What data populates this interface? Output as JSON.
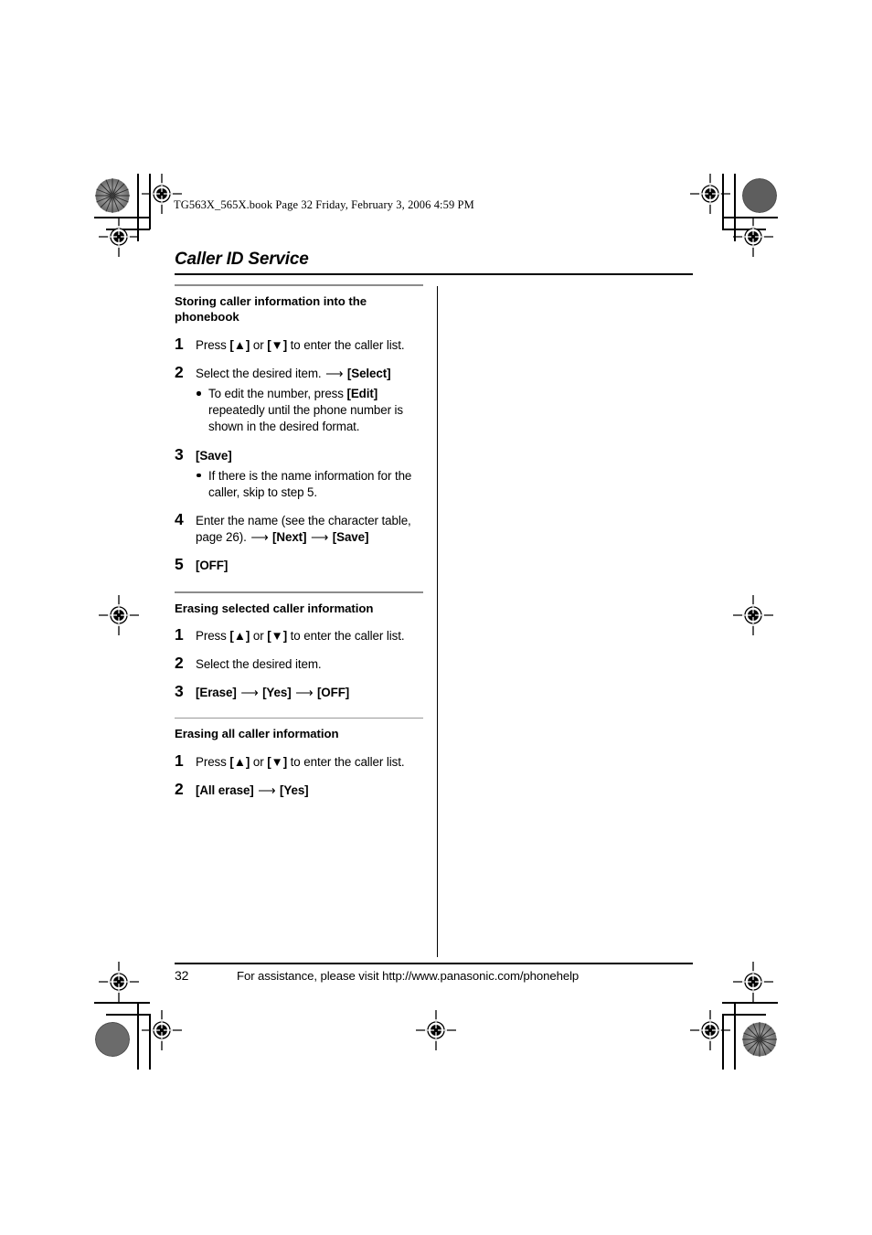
{
  "print_stamp": "TG563X_565X.book  Page 32  Friday, February 3, 2006  4:59 PM",
  "header": {
    "title": "Caller ID Service"
  },
  "sections": [
    {
      "title": "Storing caller information into the phonebook",
      "rule": "thick",
      "steps": [
        {
          "num": "1",
          "parts": [
            {
              "type": "text",
              "text": "Press "
            },
            {
              "type": "key",
              "text": "[▲]"
            },
            {
              "type": "text",
              "text": " or "
            },
            {
              "type": "key",
              "text": "[▼]"
            },
            {
              "type": "text",
              "text": " to enter the caller list."
            }
          ],
          "subs": []
        },
        {
          "num": "2",
          "parts": [
            {
              "type": "text",
              "text": "Select the desired item. "
            },
            {
              "type": "arrow",
              "text": "⟶"
            },
            {
              "type": "text",
              "text": " "
            },
            {
              "type": "key",
              "text": "[Select]"
            }
          ],
          "subs": [
            {
              "parts": [
                {
                  "type": "text",
                  "text": "To edit the number, press "
                },
                {
                  "type": "key",
                  "text": "[Edit]"
                },
                {
                  "type": "text",
                  "text": " repeatedly until the phone number is shown in the desired format."
                }
              ]
            }
          ]
        },
        {
          "num": "3",
          "parts": [
            {
              "type": "key",
              "text": "[Save]"
            }
          ],
          "subs": [
            {
              "parts": [
                {
                  "type": "text",
                  "text": "If there is the name information for the caller, skip to step 5."
                }
              ]
            }
          ]
        },
        {
          "num": "4",
          "parts": [
            {
              "type": "text",
              "text": "Enter the name (see the character table, page 26). "
            },
            {
              "type": "arrow",
              "text": "⟶"
            },
            {
              "type": "text",
              "text": " "
            },
            {
              "type": "key",
              "text": "[Next]"
            },
            {
              "type": "text",
              "text": " "
            },
            {
              "type": "arrow",
              "text": "⟶"
            },
            {
              "type": "text",
              "text": " "
            },
            {
              "type": "key",
              "text": "[Save]"
            }
          ],
          "subs": []
        },
        {
          "num": "5",
          "parts": [
            {
              "type": "key",
              "text": "[OFF]"
            }
          ],
          "subs": []
        }
      ]
    },
    {
      "title": "Erasing selected caller information",
      "rule": "thick",
      "steps": [
        {
          "num": "1",
          "parts": [
            {
              "type": "text",
              "text": "Press "
            },
            {
              "type": "key",
              "text": "[▲]"
            },
            {
              "type": "text",
              "text": " or "
            },
            {
              "type": "key",
              "text": "[▼]"
            },
            {
              "type": "text",
              "text": " to enter the caller list."
            }
          ],
          "subs": []
        },
        {
          "num": "2",
          "parts": [
            {
              "type": "text",
              "text": "Select the desired item."
            }
          ],
          "subs": []
        },
        {
          "num": "3",
          "parts": [
            {
              "type": "key",
              "text": "[Erase]"
            },
            {
              "type": "text",
              "text": " "
            },
            {
              "type": "arrow",
              "text": "⟶"
            },
            {
              "type": "text",
              "text": " "
            },
            {
              "type": "key",
              "text": "[Yes]"
            },
            {
              "type": "text",
              "text": " "
            },
            {
              "type": "arrow",
              "text": "⟶"
            },
            {
              "type": "text",
              "text": " "
            },
            {
              "type": "key",
              "text": "[OFF]"
            }
          ],
          "subs": []
        }
      ]
    },
    {
      "title": "Erasing all caller information",
      "rule": "thin",
      "steps": [
        {
          "num": "1",
          "parts": [
            {
              "type": "text",
              "text": "Press "
            },
            {
              "type": "key",
              "text": "[▲]"
            },
            {
              "type": "text",
              "text": " or "
            },
            {
              "type": "key",
              "text": "[▼]"
            },
            {
              "type": "text",
              "text": " to enter the caller list."
            }
          ],
          "subs": []
        },
        {
          "num": "2",
          "parts": [
            {
              "type": "key",
              "text": "[All erase]"
            },
            {
              "type": "text",
              "text": " "
            },
            {
              "type": "arrow",
              "text": "⟶"
            },
            {
              "type": "text",
              "text": " "
            },
            {
              "type": "key",
              "text": "[Yes]"
            }
          ],
          "subs": []
        }
      ]
    }
  ],
  "footer": {
    "page_number": "32",
    "assistance_text": "For assistance, please visit http://www.panasonic.com/phonehelp"
  }
}
